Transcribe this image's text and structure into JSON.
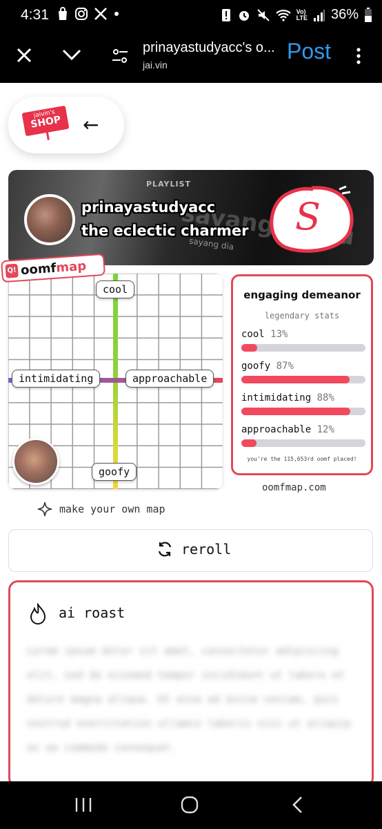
{
  "status_bar": {
    "time": "4:31",
    "battery": "36%",
    "left_icons": [
      "shopping-bag-icon",
      "instagram-icon",
      "x-icon",
      "dot-icon"
    ],
    "right_icons": [
      "alert-icon",
      "alarm-icon",
      "mute-icon",
      "wifi-icon",
      "volte-icon",
      "signal-icon",
      "battery-icon"
    ],
    "volte_label": "Vo)\nLTE"
  },
  "browser": {
    "title": "prinayastudyacc's o...",
    "url": "jai.vin",
    "post_label": "Post"
  },
  "shop": {
    "logo_line1": "jaivin's",
    "logo_line2": "SHOP",
    "back_arrow": "←"
  },
  "banner": {
    "playlist_label": "PLAYLIST",
    "bg_text": "sayang kamu",
    "bg_subtext": "sayang dia",
    "username": "prinayastudyacc",
    "tagline": "the eclectic charmer",
    "badge_letter": "S"
  },
  "map": {
    "brand_prefix": "oomf",
    "brand_suffix": "map",
    "labels": {
      "top": "cool",
      "left": "intimidating",
      "right": "approachable",
      "bottom": "goofy"
    },
    "make_own": "make your own map",
    "site": "oomfmap.com"
  },
  "stats": {
    "title": "engaging demeanor",
    "subtitle": "legendary stats",
    "items": [
      {
        "label": "cool",
        "pct": "13%",
        "value": 0.13
      },
      {
        "label": "goofy",
        "pct": "87%",
        "value": 0.87
      },
      {
        "label": "intimidating",
        "pct": "88%",
        "value": 0.88
      },
      {
        "label": "approachable",
        "pct": "12%",
        "value": 0.12
      }
    ],
    "footer": "you're the 115,653rd oomf placed!"
  },
  "reroll": {
    "label": "reroll"
  },
  "roast": {
    "title": "ai roast",
    "blurred_text": "Lorem ipsum dolor sit amet, consectetur adipiscing elit, sed do eiusmod tempor incididunt ut labore et dolore magna aliqua. Ut enim ad minim veniam, quis nostrud exercitation ullamco laboris nisi ut aliquip ex ea commodo consequat."
  },
  "colors": {
    "accent_red": "#e2475a",
    "bar_fill": "#f1495d",
    "bar_track": "#d4d4dc",
    "post_blue": "#2d9bf0",
    "axis_green": "#7ed13c",
    "axis_yellow": "#f0d93a",
    "axis_purple": "#9c5a9c"
  }
}
